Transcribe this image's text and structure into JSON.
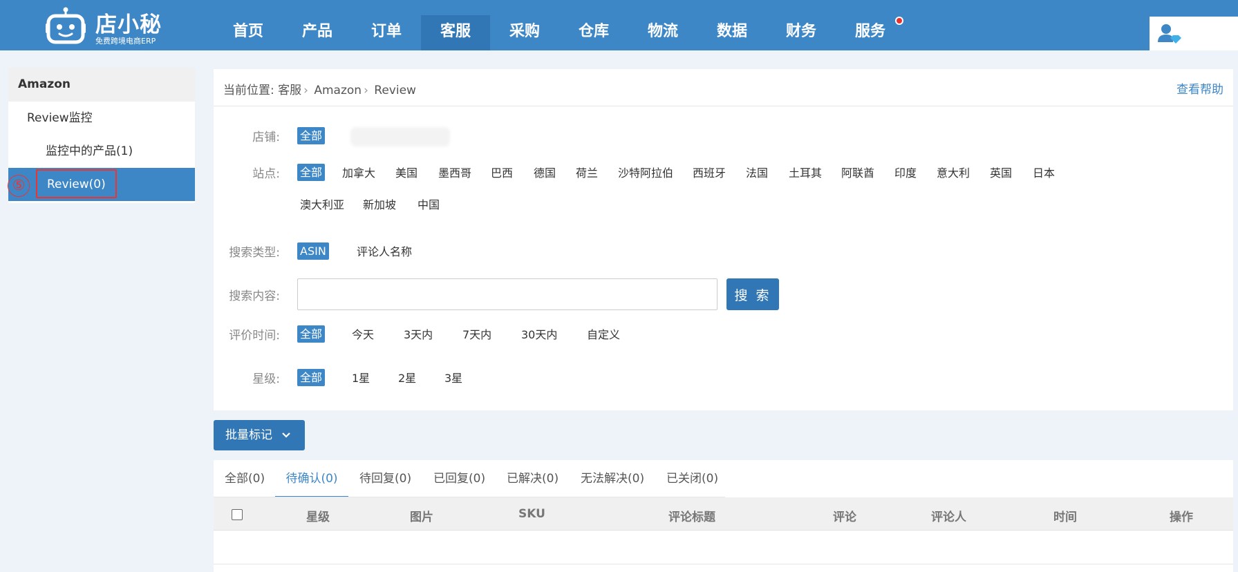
{
  "header": {
    "brand": "店小秘",
    "slogan": "免费跨境电商ERP",
    "nav": [
      "首页",
      "产品",
      "订单",
      "客服",
      "采购",
      "仓库",
      "物流",
      "数据",
      "财务",
      "服务"
    ],
    "active_nav": "客服"
  },
  "sidebar": {
    "title": "Amazon",
    "items": [
      {
        "label": "Review监控",
        "level": 1
      },
      {
        "label": "监控中的产品(1)",
        "level": 2
      },
      {
        "label": "Review(0)",
        "level": 2,
        "active": true
      }
    ],
    "step_marker": "⑤"
  },
  "breadcrumb": {
    "prefix": "当前位置:",
    "parts": [
      "客服",
      "Amazon",
      "Review"
    ],
    "help": "查看帮助"
  },
  "filters": {
    "store": {
      "label": "店铺:",
      "options": [
        "全部"
      ]
    },
    "site": {
      "label": "站点:",
      "options": [
        "全部",
        "加拿大",
        "美国",
        "墨西哥",
        "巴西",
        "德国",
        "荷兰",
        "沙特阿拉伯",
        "西班牙",
        "法国",
        "土耳其",
        "阿联酋",
        "印度",
        "意大利",
        "英国",
        "日本",
        "澳大利亚",
        "新加坡",
        "中国"
      ]
    },
    "search_type": {
      "label": "搜索类型:",
      "options": [
        "ASIN",
        "评论人名称"
      ]
    },
    "search_content": {
      "label": "搜索内容:",
      "value": "",
      "placeholder": "",
      "button": "搜 索"
    },
    "review_time": {
      "label": "评价时间:",
      "options": [
        "全部",
        "今天",
        "3天内",
        "7天内",
        "30天内",
        "自定义"
      ]
    },
    "rating": {
      "label": "星级:",
      "options": [
        "全部",
        "1星",
        "2星",
        "3星"
      ]
    }
  },
  "batch_button": "批量标记",
  "tabs": [
    "全部(0)",
    "待确认(0)",
    "待回复(0)",
    "已回复(0)",
    "已解决(0)",
    "无法解决(0)",
    "已关闭(0)"
  ],
  "active_tab": "待确认(0)",
  "table": {
    "columns": [
      "星级",
      "图片",
      "SKU",
      "评论标题",
      "评论",
      "评论人",
      "时间",
      "操作"
    ]
  },
  "colors": {
    "primary": "#3d87c7",
    "primary_dark": "#3277b5",
    "marker_red": "#e33333"
  }
}
